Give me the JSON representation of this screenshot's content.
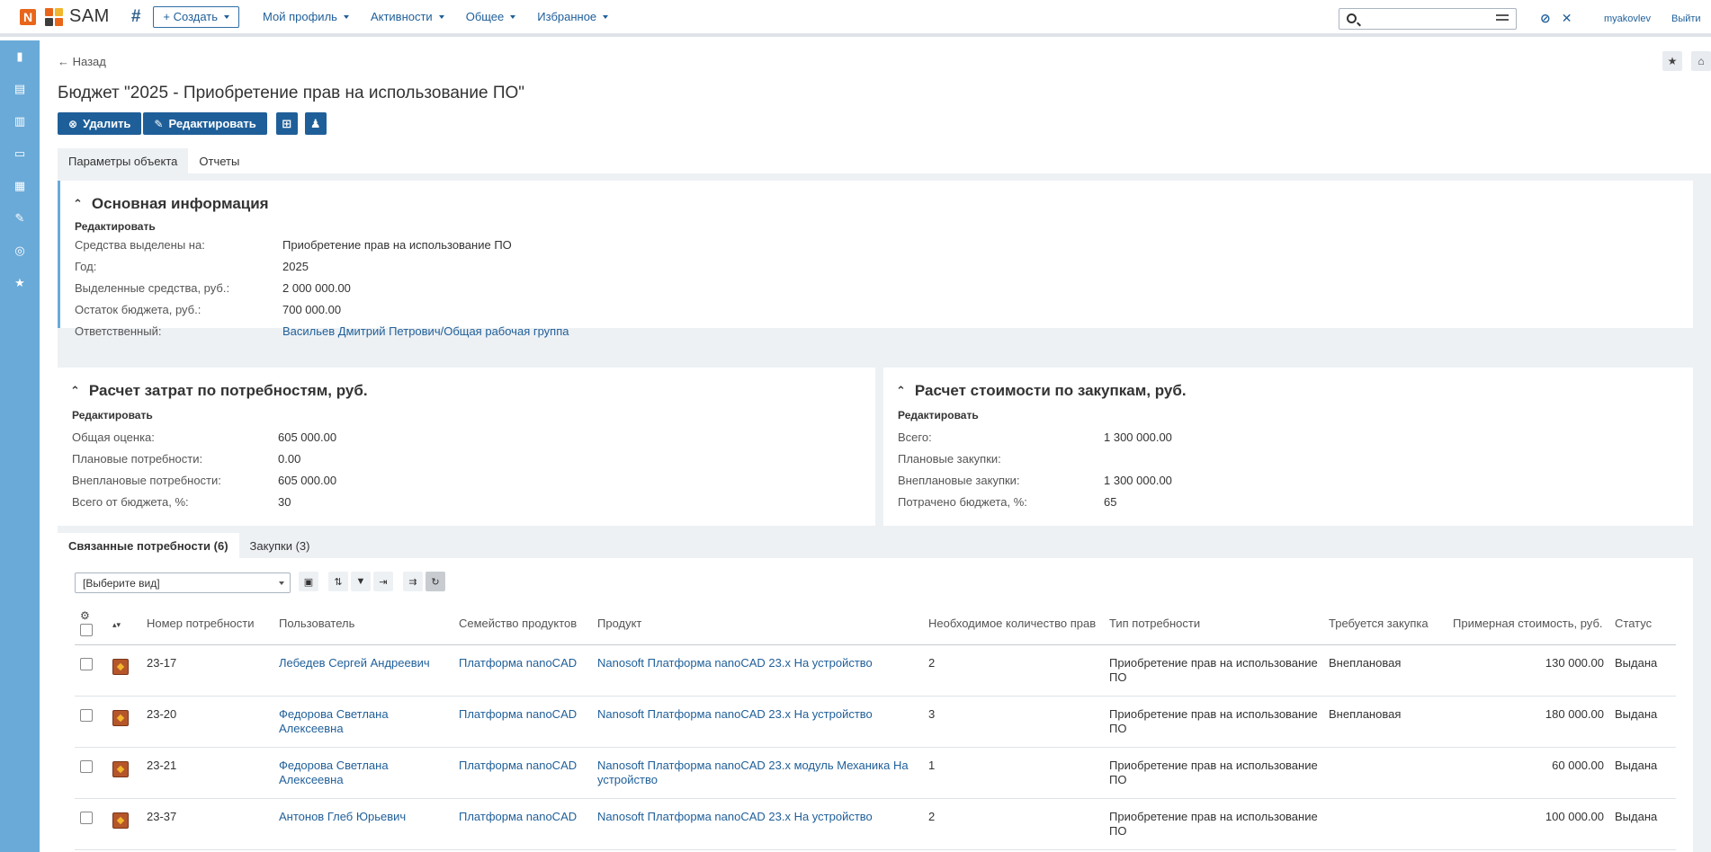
{
  "header": {
    "brand": "SAM",
    "create": "+ Создать",
    "nav": [
      "Мой профиль",
      "Активности",
      "Общее",
      "Избранное"
    ],
    "user": "myakovlev",
    "logout": "Выйти"
  },
  "page": {
    "back": "← Назад",
    "title": "Бюджет \"2025 - Приобретение прав на использование ПО\"",
    "delete": "Удалить",
    "edit": "Редактировать",
    "tabs": [
      "Параметры объекта",
      "Отчеты"
    ]
  },
  "main_info": {
    "title": "Основная информация",
    "edit": "Редактировать",
    "labels": [
      "Средства выделены на:",
      "Год:",
      "Выделенные средства, руб.:",
      "Остаток бюджета, руб.:",
      "Ответственный:"
    ],
    "values": [
      "Приобретение прав на использование ПО",
      "2025",
      "2 000 000.00",
      "700 000.00",
      "Васильев Дмитрий Петрович/Общая рабочая группа"
    ]
  },
  "needs_calc": {
    "title": "Расчет затрат по потребностям, руб.",
    "edit": "Редактировать",
    "labels": [
      "Общая оценка:",
      "Плановые потребности:",
      "Внеплановые потребности:",
      "Всего от бюджета, %:"
    ],
    "values": [
      "605 000.00",
      "0.00",
      "605 000.00",
      "30"
    ]
  },
  "purchase_calc": {
    "title": "Расчет стоимости по закупкам, руб.",
    "edit": "Редактировать",
    "labels": [
      "Всего:",
      "Плановые закупки:",
      "Внеплановые закупки:",
      "Потрачено бюджета, %:"
    ],
    "values": [
      "1 300 000.00",
      "",
      "1 300 000.00",
      "65"
    ]
  },
  "related": {
    "tabs": [
      "Связанные потребности (6)",
      "Закупки (3)"
    ],
    "view_placeholder": "[Выберите вид]",
    "columns": [
      "Номер потребности",
      "Пользователь",
      "Семейство продуктов",
      "Продукт",
      "Необходимое количество прав",
      "Тип потребности",
      "Требуется закупка",
      "Примерная стоимость, руб.",
      "Статус"
    ],
    "rows": [
      {
        "num": "23-17",
        "user": "Лебедев Сергей Андреевич",
        "family": "Платформа nanoCAD",
        "product": "Nanosoft Платформа nanoCAD 23.x На устройство",
        "qty": "2",
        "type": "Приобретение прав на использование ПО",
        "purchase": "Внеплановая",
        "cost": "130 000.00",
        "status": "Выдана"
      },
      {
        "num": "23-20",
        "user": "Федорова Светлана Алексеевна",
        "family": "Платформа nanoCAD",
        "product": "Nanosoft Платформа nanoCAD 23.x На устройство",
        "qty": "3",
        "type": "Приобретение прав на использование ПО",
        "purchase": "Внеплановая",
        "cost": "180 000.00",
        "status": "Выдана"
      },
      {
        "num": "23-21",
        "user": "Федорова Светлана Алексеевна",
        "family": "Платформа nanoCAD",
        "product": "Nanosoft Платформа nanoCAD 23.x модуль Механика На устройство",
        "qty": "1",
        "type": "Приобретение прав на использование ПО",
        "purchase": "",
        "cost": "60 000.00",
        "status": "Выдана"
      },
      {
        "num": "23-37",
        "user": "Антонов Глеб Юрьевич",
        "family": "Платформа nanoCAD",
        "product": "Nanosoft Платформа nanoCAD 23.x На устройство",
        "qty": "2",
        "type": "Приобретение прав на использование ПО",
        "purchase": "",
        "cost": "100 000.00",
        "status": "Выдана"
      }
    ]
  },
  "colors": {
    "accent": "#1f5f99",
    "sidebar": "#6aaad8",
    "logo": "#e8651a"
  }
}
